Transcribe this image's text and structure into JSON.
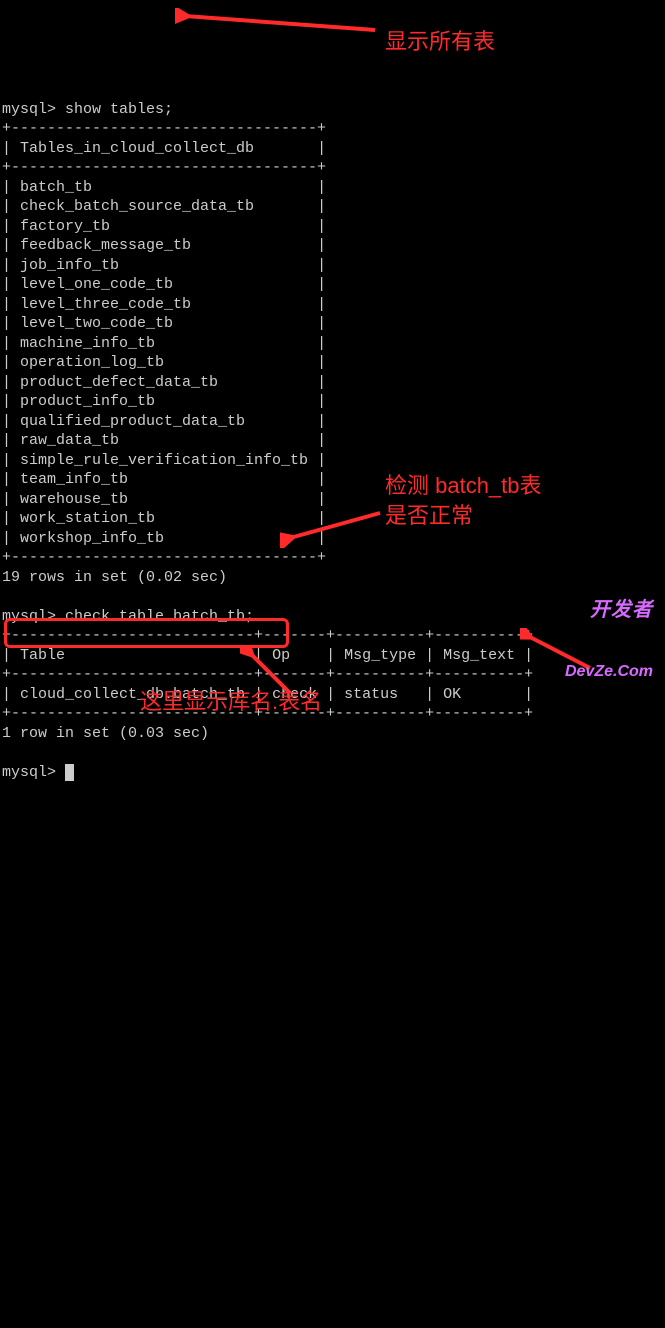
{
  "terminal": {
    "prompt": "mysql>",
    "cmd_show_tables": "show tables;",
    "tables_header": "Tables_in_cloud_collect_db",
    "tables": [
      "batch_tb",
      "check_batch_source_data_tb",
      "factory_tb",
      "feedback_message_tb",
      "job_info_tb",
      "level_one_code_tb",
      "level_three_code_tb",
      "level_two_code_tb",
      "machine_info_tb",
      "operation_log_tb",
      "product_defect_data_tb",
      "product_info_tb",
      "qualified_product_data_tb",
      "raw_data_tb",
      "simple_rule_verification_info_tb",
      "team_info_tb",
      "warehouse_tb",
      "work_station_tb",
      "workshop_info_tb"
    ],
    "rows_result1": "19 rows in set (0.02 sec)",
    "cmd_check_table": "check table batch_tb;",
    "check_headers": {
      "table": "Table",
      "op": "Op",
      "msgtype": "Msg_type",
      "msgtext": "Msg_text"
    },
    "check_row": {
      "table": "cloud_collect_db.batch_tb",
      "op": "check",
      "msgtype": "status",
      "msgtext": "OK"
    },
    "rows_result2": "1 row in set (0.03 sec)"
  },
  "annotations": {
    "a1": "显示所有表",
    "a2_line1": "检测 batch_tb表",
    "a2_line2": "是否正常",
    "a3": "这里显示库名.表名"
  },
  "watermark": {
    "line1": "开发者",
    "line2": "DevZe.Com"
  }
}
